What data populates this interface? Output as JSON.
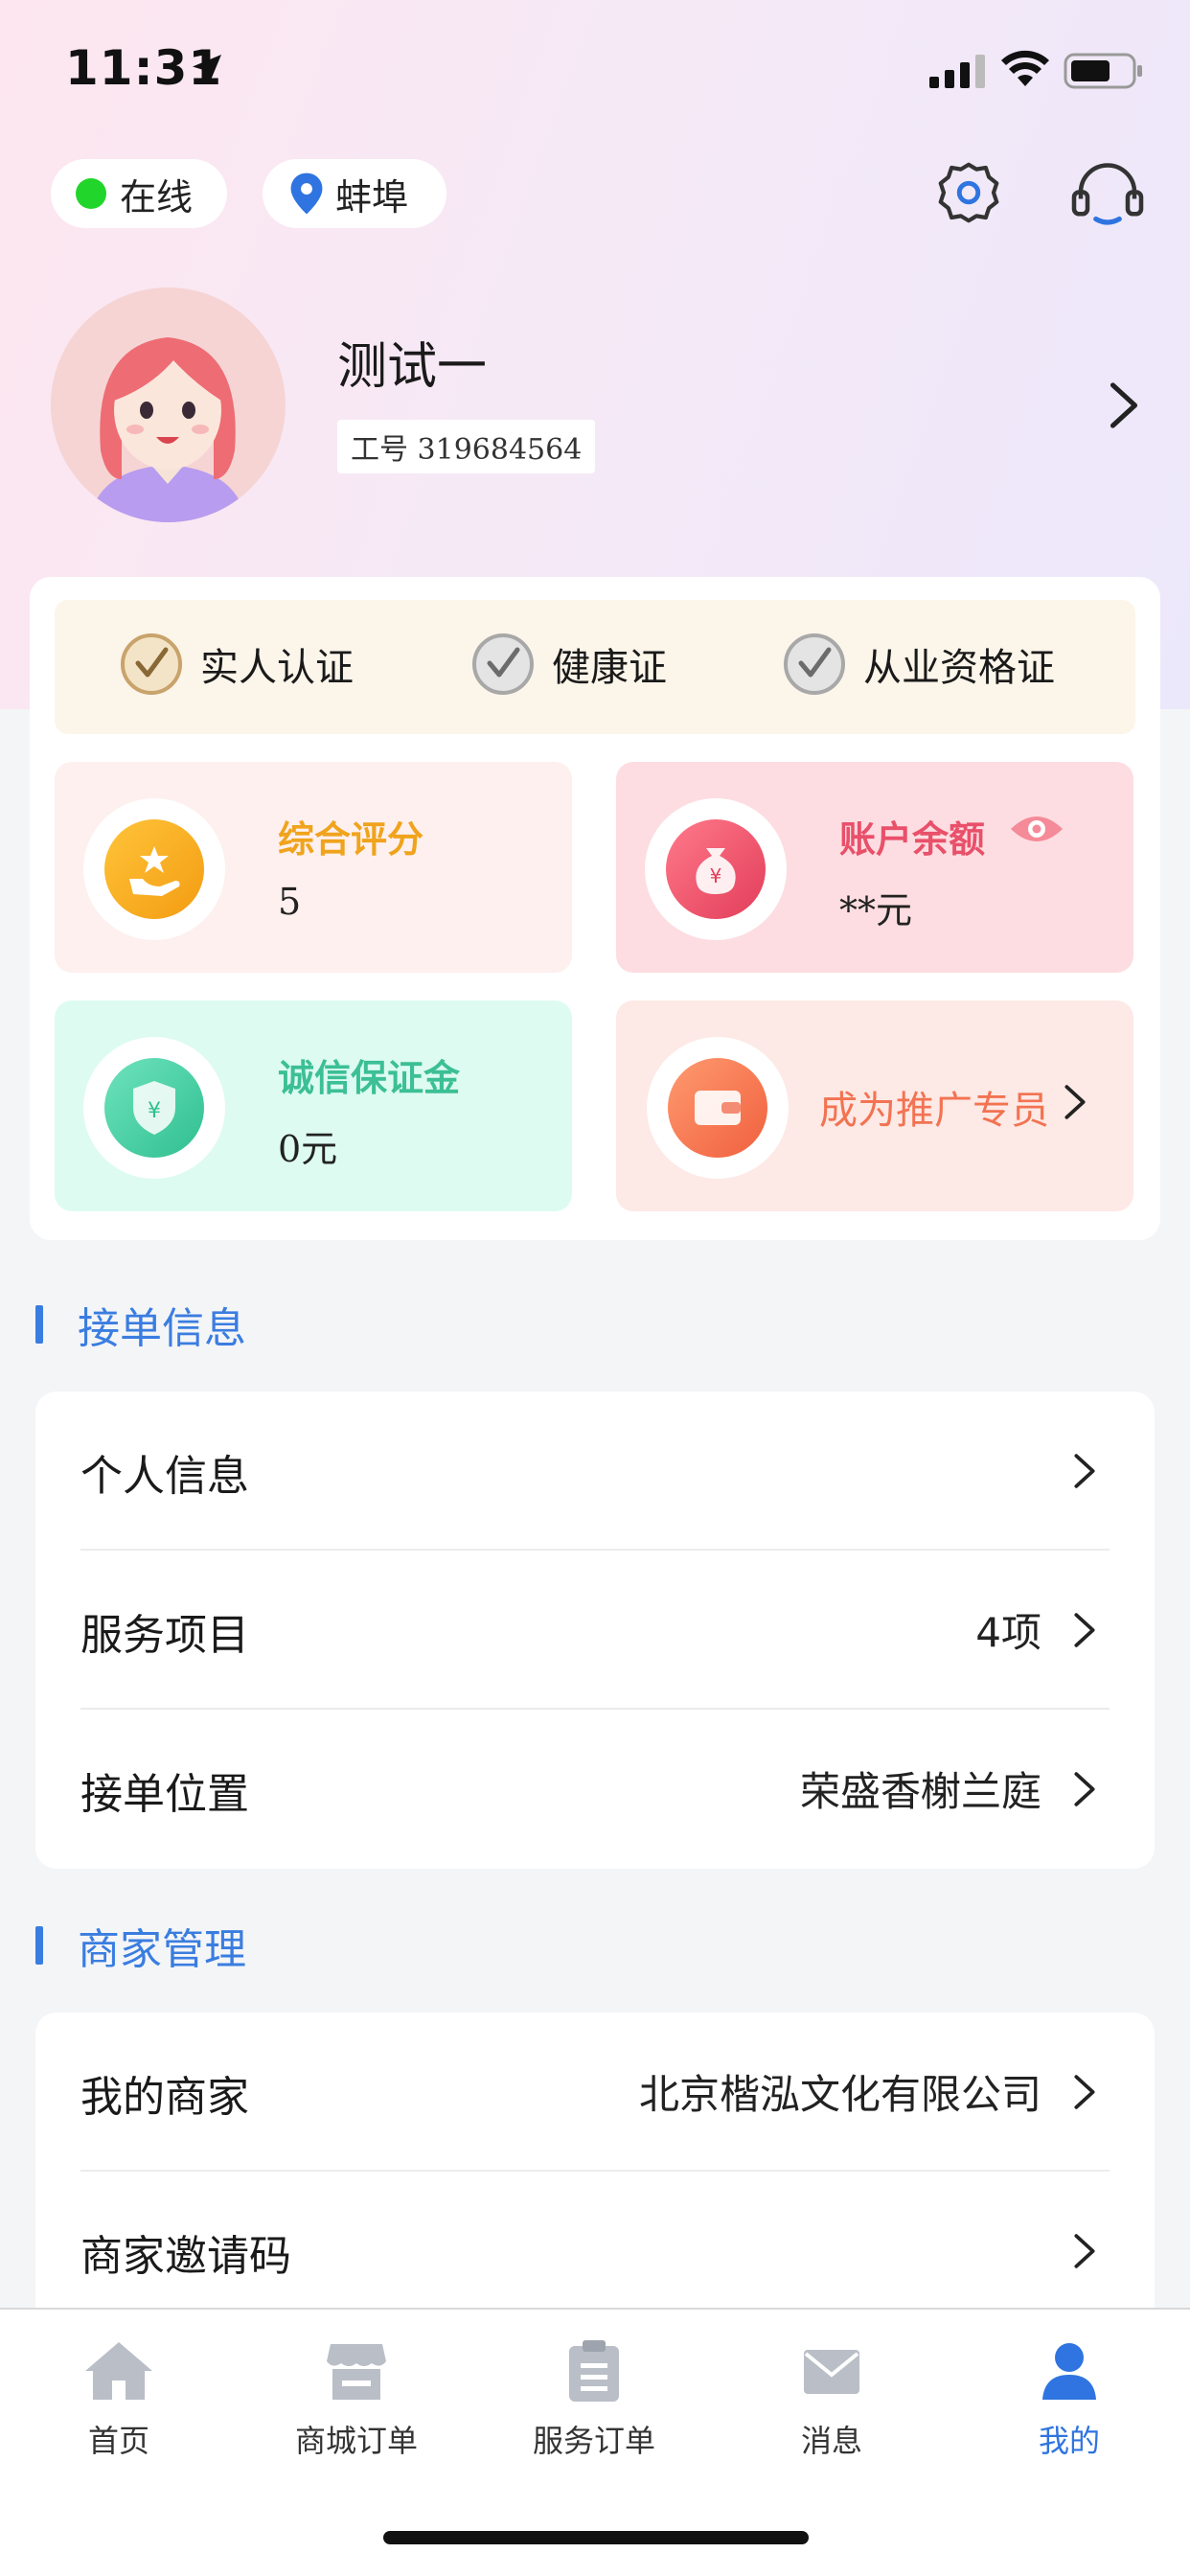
{
  "status_bar": {
    "time": "11:31"
  },
  "header": {
    "online_label": "在线",
    "city_label": "蚌埠"
  },
  "profile": {
    "name": "测试一",
    "employee_id": "工号 319684564"
  },
  "certifications": [
    {
      "label": "实人认证",
      "verified": true
    },
    {
      "label": "健康证",
      "verified": false
    },
    {
      "label": "从业资格证",
      "verified": false
    }
  ],
  "stats": {
    "score": {
      "label": "综合评分",
      "value": "5"
    },
    "balance": {
      "label": "账户余额",
      "value": "**元"
    },
    "deposit": {
      "label": "诚信保证金",
      "value": "0元"
    },
    "promoter": {
      "label": "成为推广专员"
    }
  },
  "sections": {
    "orders": {
      "title": "接单信息",
      "rows": [
        {
          "label": "个人信息",
          "value": ""
        },
        {
          "label": "服务项目",
          "value": "4项"
        },
        {
          "label": "接单位置",
          "value": "荣盛香榭兰庭"
        }
      ]
    },
    "merchant": {
      "title": "商家管理",
      "rows": [
        {
          "label": "我的商家",
          "value": "北京楷泓文化有限公司"
        },
        {
          "label": "商家邀请码",
          "value": ""
        }
      ]
    }
  },
  "tabbar": {
    "items": [
      {
        "label": "首页",
        "icon": "home-icon",
        "active": false
      },
      {
        "label": "商城订单",
        "icon": "store-icon",
        "active": false
      },
      {
        "label": "服务订单",
        "icon": "clipboard-icon",
        "active": false
      },
      {
        "label": "消息",
        "icon": "mail-icon",
        "active": false
      },
      {
        "label": "我的",
        "icon": "user-icon",
        "active": true
      }
    ]
  },
  "colors": {
    "accent": "#3a7de0",
    "online": "#22d52b",
    "score": "#f0a31c",
    "balance": "#e9506a",
    "deposit": "#3cbf95",
    "promoter": "#f27352"
  }
}
